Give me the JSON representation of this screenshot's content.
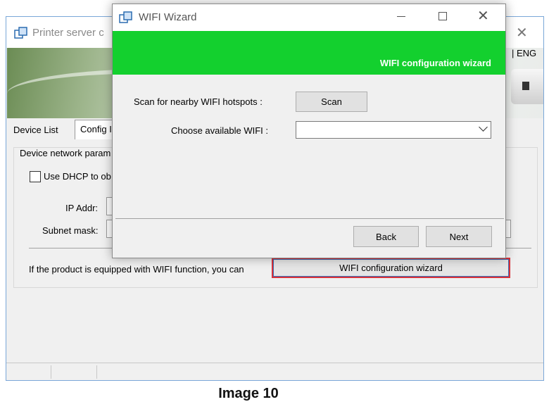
{
  "main_window": {
    "title": "Printer server c",
    "language": "| ENG",
    "tabs": [
      {
        "label": "Device List"
      },
      {
        "label": "Config I"
      }
    ],
    "group_label": "Device network param",
    "dhcp_label": "Use DHCP to ob",
    "dhcp_checked": false,
    "ip_label": "IP Addr:",
    "mask_label": "Subnet mask:",
    "wifi_hint": "If the product is equipped with WIFI function, you can",
    "wizard_button": "WIFI configuration wizard"
  },
  "wizard": {
    "title": "WIFI Wizard",
    "header_title": "WIFI configuration wizard",
    "header_color": "#13d02e",
    "scan_label": "Scan for nearby WIFI hotspots :",
    "scan_button": "Scan",
    "choose_label": "Choose available WIFI :",
    "wifi_selected": "",
    "back_button": "Back",
    "next_button": "Next"
  },
  "caption": "Image 10"
}
